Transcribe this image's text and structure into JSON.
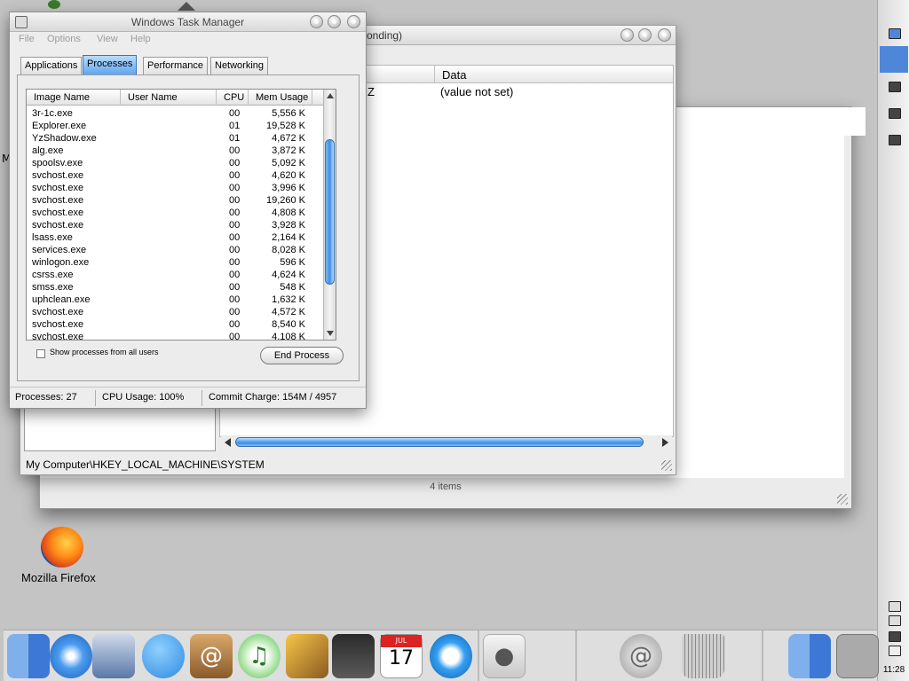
{
  "finder": {
    "status": "4 items"
  },
  "regedit": {
    "title_fragment": "onding)",
    "column_data": "Data",
    "row_name_fragment": "Z",
    "row_data": "(value not set)",
    "path": "My Computer\\HKEY_LOCAL_MACHINE\\SYSTEM"
  },
  "taskmgr": {
    "title": "Windows Task Manager",
    "menu": [
      "File",
      "Options",
      "View",
      "Help"
    ],
    "tabs": [
      "Applications",
      "Processes",
      "Performance",
      "Networking"
    ],
    "active_tab": "Processes",
    "columns": [
      "Image Name",
      "User Name",
      "CPU",
      "Mem Usage"
    ],
    "processes": [
      {
        "name": "3r-1c.exe",
        "cpu": "00",
        "mem": "5,556 K"
      },
      {
        "name": "Explorer.exe",
        "cpu": "01",
        "mem": "19,528 K"
      },
      {
        "name": "YzShadow.exe",
        "cpu": "01",
        "mem": "4,672 K"
      },
      {
        "name": "alg.exe",
        "cpu": "00",
        "mem": "3,872 K"
      },
      {
        "name": "spoolsv.exe",
        "cpu": "00",
        "mem": "5,092 K"
      },
      {
        "name": "svchost.exe",
        "cpu": "00",
        "mem": "4,620 K"
      },
      {
        "name": "svchost.exe",
        "cpu": "00",
        "mem": "3,996 K"
      },
      {
        "name": "svchost.exe",
        "cpu": "00",
        "mem": "19,260 K"
      },
      {
        "name": "svchost.exe",
        "cpu": "00",
        "mem": "4,808 K"
      },
      {
        "name": "svchost.exe",
        "cpu": "00",
        "mem": "3,928 K"
      },
      {
        "name": "lsass.exe",
        "cpu": "00",
        "mem": "2,164 K"
      },
      {
        "name": "services.exe",
        "cpu": "00",
        "mem": "8,028 K"
      },
      {
        "name": "winlogon.exe",
        "cpu": "00",
        "mem": "596 K"
      },
      {
        "name": "csrss.exe",
        "cpu": "00",
        "mem": "4,624 K"
      },
      {
        "name": "smss.exe",
        "cpu": "00",
        "mem": "548 K"
      },
      {
        "name": "uphclean.exe",
        "cpu": "00",
        "mem": "1,632 K"
      },
      {
        "name": "svchost.exe",
        "cpu": "00",
        "mem": "4,572 K"
      },
      {
        "name": "svchost.exe",
        "cpu": "00",
        "mem": "8,540 K"
      },
      {
        "name": "svchost.exe",
        "cpu": "00",
        "mem": "4,108 K"
      }
    ],
    "show_all_label": "Show processes from all users",
    "end_process_label": "End Process",
    "status": {
      "processes": "Processes: 27",
      "cpu": "CPU Usage: 100%",
      "commit": "Commit Charge: 154M / 4957"
    }
  },
  "desktop": {
    "firefox_label": "Mozilla Firefox",
    "partial_letter": "M"
  },
  "side_dock": {
    "clock": "11:28"
  },
  "dock": {
    "icons": [
      "finder-icon",
      "safari-icon",
      "mail-icon",
      "ichat-icon",
      "address-book-icon",
      "itunes-icon",
      "iphoto-icon",
      "imovie-icon",
      "ical-icon",
      "quicktime-icon",
      "system-preferences-icon",
      "mail-drop-icon",
      "trash-icon",
      "finder-icon-2",
      "window-icon"
    ],
    "ical_month": "JUL",
    "ical_day": "17"
  },
  "colors": {
    "aqua_blue": "#3c8de8",
    "desktop_bg": "#c4c4c4"
  }
}
